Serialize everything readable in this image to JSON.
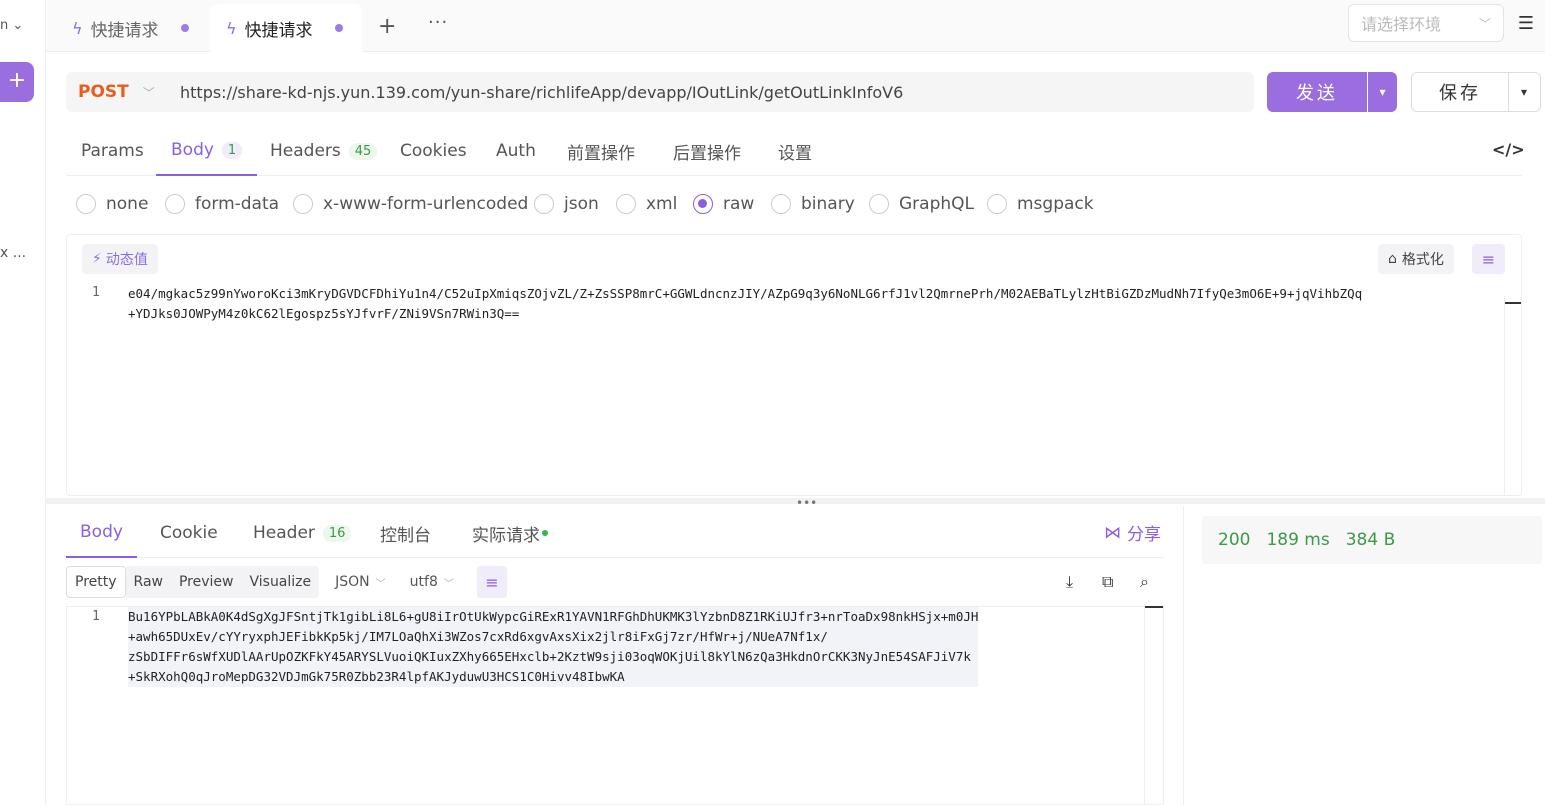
{
  "sidebar": {
    "top_label": "n",
    "add_label": "+",
    "truncated_label": "x ..."
  },
  "tabs": [
    {
      "label": "快捷请求"
    },
    {
      "label": "快捷请求"
    }
  ],
  "tab_actions": {
    "add": "+",
    "more": "···"
  },
  "environment": {
    "placeholder": "请选择环境"
  },
  "request": {
    "method": "POST",
    "url": "https://share-kd-njs.yun.139.com/yun-share/richlifeApp/devapp/IOutLink/getOutLinkInfoV6",
    "send_label": "发送",
    "save_label": "保存"
  },
  "request_tabs": [
    {
      "label": "Params",
      "badge": ""
    },
    {
      "label": "Body",
      "badge": "1"
    },
    {
      "label": "Headers",
      "badge": "45"
    },
    {
      "label": "Cookies",
      "badge": ""
    },
    {
      "label": "Auth",
      "badge": ""
    },
    {
      "label": "前置操作",
      "badge": ""
    },
    {
      "label": "后置操作",
      "badge": ""
    },
    {
      "label": "设置",
      "badge": ""
    }
  ],
  "body_types": [
    "none",
    "form-data",
    "x-www-form-urlencoded",
    "json",
    "xml",
    "raw",
    "binary",
    "GraphQL",
    "msgpack"
  ],
  "body_type_selected": "raw",
  "editor": {
    "dynamic_value_label": "动态值",
    "format_label": "格式化",
    "line_number": "1",
    "content": "e04/mgkac5z99nYworoKci3mKryDGVDCFDhiYu1n4/C52uIpXmiqsZOjvZL/Z+ZsSSP8mrC+GGWLdncnzJIY/AZpG9q3y6NoNLG6rfJ1vl2QmrnePrh/M02AEBaTLylzHtBiGZDzMudNh7IfyQe3mO6E+9+jqVihbZQq\n+YDJks0JOWPyM4z0kC62lEgospz5sYJfvrF/ZNi9VSn7RWin3Q=="
  },
  "response_tabs": [
    {
      "label": "Body",
      "badge": ""
    },
    {
      "label": "Cookie",
      "badge": ""
    },
    {
      "label": "Header",
      "badge": "16"
    },
    {
      "label": "控制台",
      "badge": ""
    },
    {
      "label": "实际请求",
      "badge": ""
    }
  ],
  "share_label": "分享",
  "response_views": [
    "Pretty",
    "Raw",
    "Preview",
    "Visualize"
  ],
  "response_format": "JSON",
  "response_encoding": "utf8",
  "response": {
    "line_number": "1",
    "content": "Bu16YPbLABkA0K4dSgXgJFSntjTk1gibLi8L6+gU8iIrOtUkWypcGiRExR1YAVN1RFGhDhUKMK3lYzbnD8Z1RKiUJfr3+nrToaDx98nkHSjx+m0JH\n+awh65DUxEv/cYYryxphJEFibkKp5kj/IM7LOaQhXi3WZos7cxRd6xgvAxsXix2jlr8iFxGj7zr/HfWr+j/NUeA7Nf1x/\nzSbDIFFr6sWfXUDlAArUpOZKFkY45ARYSLVuoiQKIuxZXhy665EHxclb+2KztW9sji03oqWOKjUil8kYlN6zQa3HkdnOrCKK3NyJnE54SAFJiV7k\n+SkRXohQ0qJroMepDG32VDJmGk75R0Zbb23R4lpfAKJyduwU3HCS1C0Hivv48IbwKA"
  },
  "status": {
    "code": "200",
    "time": "189 ms",
    "size": "384 B"
  },
  "colors": {
    "accent": "#8a5ee0",
    "method": "#e85d1e",
    "success": "#3a9a4a"
  }
}
